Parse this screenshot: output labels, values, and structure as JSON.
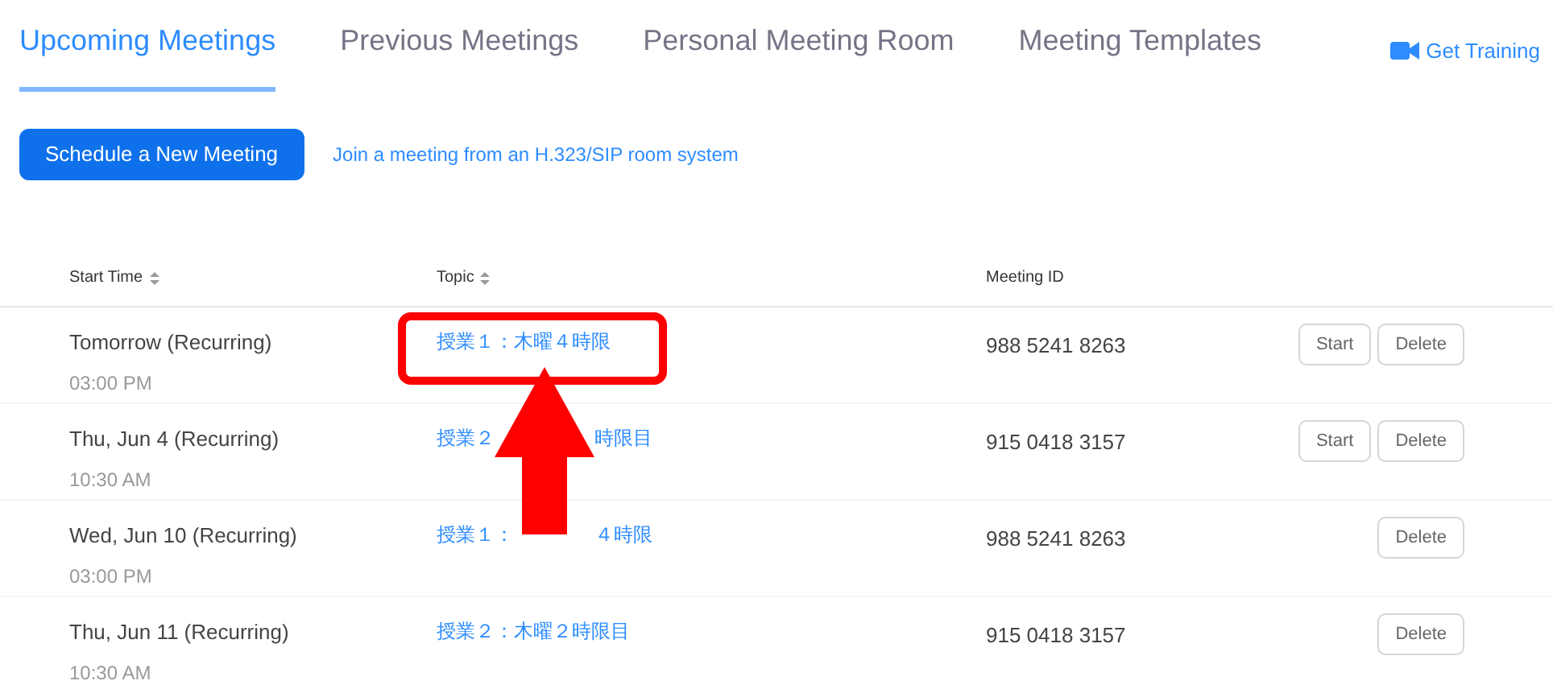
{
  "tabs": [
    {
      "label": "Upcoming Meetings",
      "selected": true
    },
    {
      "label": "Previous Meetings",
      "selected": false
    },
    {
      "label": "Personal Meeting Room",
      "selected": false
    },
    {
      "label": "Meeting Templates",
      "selected": false
    }
  ],
  "training_link": "Get Training",
  "schedule_button": "Schedule a New Meeting",
  "join_link": "Join a meeting from an H.323/SIP room system",
  "table": {
    "columns": [
      {
        "label": "Start Time",
        "sortable": true
      },
      {
        "label": "Topic",
        "sortable": true
      },
      {
        "label": "Meeting ID",
        "sortable": false
      }
    ],
    "rows": [
      {
        "date": "Tomorrow (Recurring)",
        "time": "03:00 PM",
        "topic": [
          "授業１：木曜４時限"
        ],
        "meeting_id": "988 5241 8263",
        "actions": [
          "Start",
          "Delete"
        ]
      },
      {
        "date": "Thu, Jun 4 (Recurring)",
        "time": "10:30 AM",
        "topic": [
          "授業２",
          "時限目"
        ],
        "meeting_id": "915 0418 3157",
        "actions": [
          "Start",
          "Delete"
        ]
      },
      {
        "date": "Wed, Jun 10 (Recurring)",
        "time": "03:00 PM",
        "topic": [
          "授業１：",
          "４時限"
        ],
        "meeting_id": "988 5241 8263",
        "actions": [
          "Delete"
        ]
      },
      {
        "date": "Thu, Jun 11 (Recurring)",
        "time": "10:30 AM",
        "topic": [
          "授業２：木曜２時限目"
        ],
        "meeting_id": "915 0418 3157",
        "actions": [
          "Delete"
        ]
      }
    ]
  }
}
